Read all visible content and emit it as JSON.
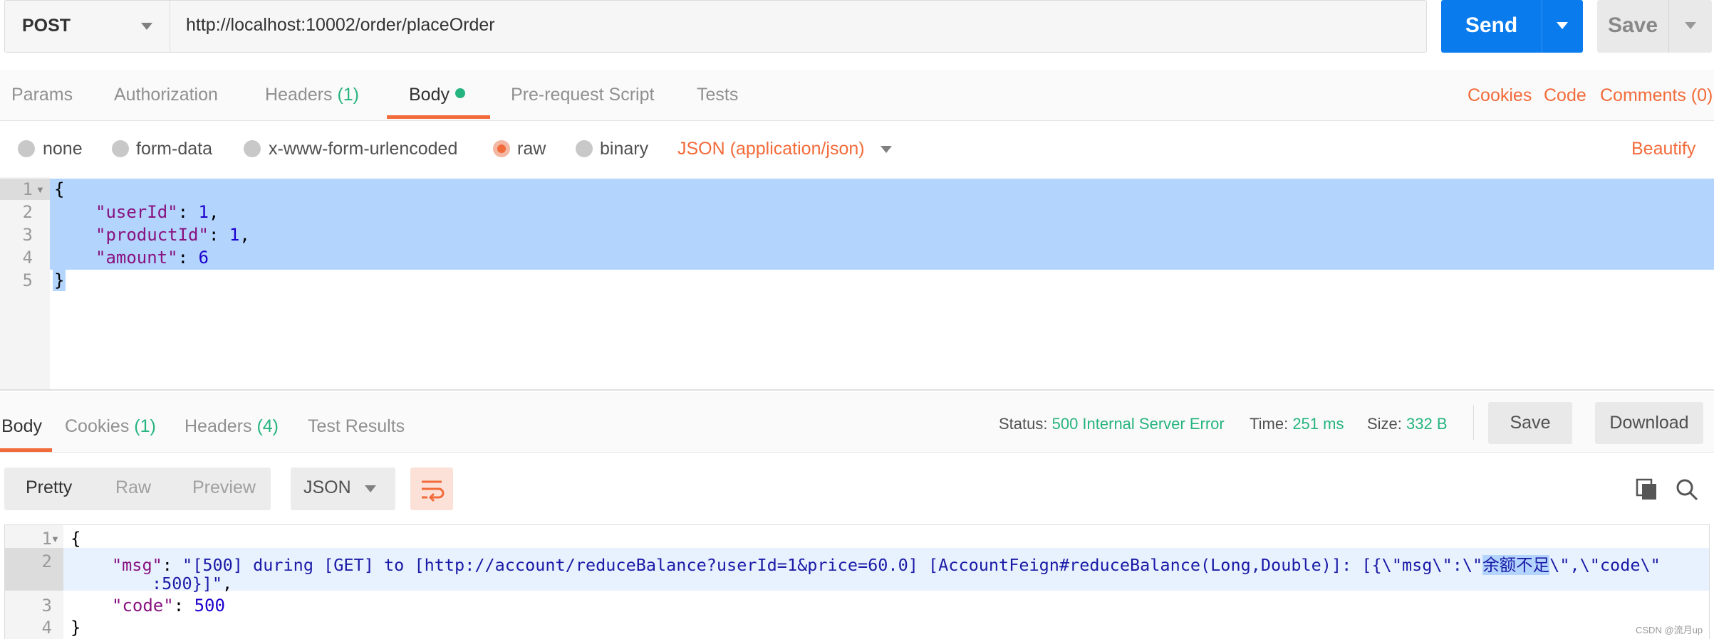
{
  "request": {
    "method": "POST",
    "url": "http://localhost:10002/order/placeOrder",
    "send_label": "Send",
    "save_label": "Save"
  },
  "request_tabs": {
    "params": "Params",
    "authorization": "Authorization",
    "headers": "Headers",
    "headers_count": "(1)",
    "body": "Body",
    "prerequest": "Pre-request Script",
    "tests": "Tests",
    "cookies": "Cookies",
    "code": "Code",
    "comments": "Comments (0)"
  },
  "body_modes": {
    "none": "none",
    "form_data": "form-data",
    "urlencoded": "x-www-form-urlencoded",
    "raw": "raw",
    "binary": "binary",
    "selected": "raw",
    "content_type": "JSON (application/json)",
    "beautify": "Beautify"
  },
  "request_body": {
    "line_numbers": [
      "1",
      "2",
      "3",
      "4",
      "5"
    ],
    "open": "{",
    "close": "}",
    "key1": "\"userId\"",
    "val1": "1",
    "key2": "\"productId\"",
    "val2": "1",
    "key3": "\"amount\"",
    "val3": "6"
  },
  "response_tabs": {
    "body": "Body",
    "cookies": "Cookies",
    "cookies_count": "(1)",
    "headers": "Headers",
    "headers_count": "(4)",
    "test_results": "Test Results"
  },
  "response_meta": {
    "status_label": "Status:",
    "status_value": "500 Internal Server Error",
    "time_label": "Time:",
    "time_value": "251 ms",
    "size_label": "Size:",
    "size_value": "332 B",
    "save_label": "Save",
    "download_label": "Download"
  },
  "response_toolbar": {
    "pretty": "Pretty",
    "raw": "Raw",
    "preview": "Preview",
    "format": "JSON",
    "wrap_icon": "wrap-lines-icon",
    "copy_icon": "copy-icon",
    "search_icon": "search-icon"
  },
  "response_body": {
    "line_numbers": [
      "1",
      "2",
      "3",
      "4"
    ],
    "open": "{",
    "close": "}",
    "msg_key": "\"msg\"",
    "msg_val_part1": "\"[500] during [GET] to [http://account/reduceBalance?userId=1&price=60.0] [AccountFeign#reduceBalance(Long,Double)]: [{\\\"msg\\\":\\\"",
    "msg_val_selected": "余额不足",
    "msg_val_part2": "\\\",\\\"code\\\"",
    "msg_val_wrap": ":500}]\"",
    "code_key": "\"code\"",
    "code_val": "500"
  },
  "watermark": "CSDN @流月up",
  "colors": {
    "accent": "#f26b3a",
    "send": "#097bed",
    "success_green": "#26b47f",
    "selection": "#b3d4fd"
  }
}
